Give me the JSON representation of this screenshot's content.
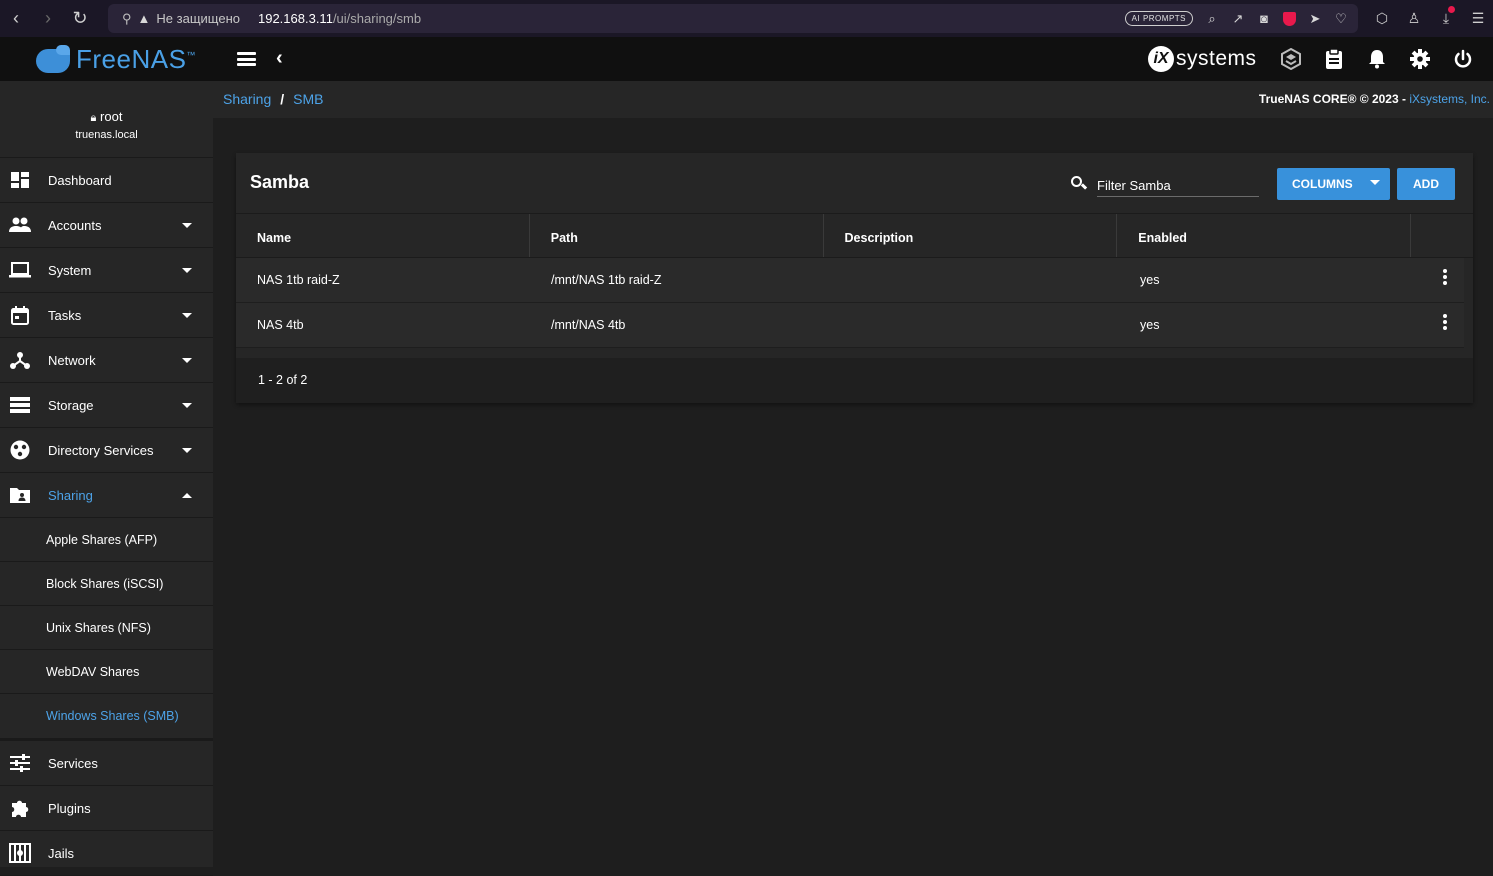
{
  "browser": {
    "insecure_label": "Не защищено",
    "url_host": "192.168.3.11",
    "url_path": "/ui/sharing/smb",
    "ai_prompts": "AI PROMPTS"
  },
  "topbar": {
    "logo_text": "FreeNAS",
    "logo_tm": "™",
    "ix_mark": "iX",
    "ix_text": "systems"
  },
  "user": {
    "name": "root",
    "host": "truenas.local"
  },
  "sidebar": {
    "items": [
      {
        "label": "Dashboard"
      },
      {
        "label": "Accounts"
      },
      {
        "label": "System"
      },
      {
        "label": "Tasks"
      },
      {
        "label": "Network"
      },
      {
        "label": "Storage"
      },
      {
        "label": "Directory Services"
      },
      {
        "label": "Sharing"
      },
      {
        "label": "Services"
      },
      {
        "label": "Plugins"
      },
      {
        "label": "Jails"
      }
    ],
    "sharing_sub": [
      {
        "label": "Apple Shares (AFP)"
      },
      {
        "label": "Block Shares (iSCSI)"
      },
      {
        "label": "Unix Shares (NFS)"
      },
      {
        "label": "WebDAV Shares"
      },
      {
        "label": "Windows Shares (SMB)"
      }
    ]
  },
  "breadcrumb": {
    "parent": "Sharing",
    "separator": "/",
    "current": "SMB"
  },
  "copyright": {
    "text": "TrueNAS CORE® © 2023 - ",
    "company": "iXsystems, Inc."
  },
  "card": {
    "title": "Samba",
    "filter_placeholder": "Filter Samba",
    "columns_label": "COLUMNS",
    "add_label": "ADD",
    "columns": [
      "Name",
      "Path",
      "Description",
      "Enabled"
    ],
    "rows": [
      {
        "name": "NAS 1tb raid-Z",
        "path": "/mnt/NAS 1tb raid-Z",
        "description": "",
        "enabled": "yes"
      },
      {
        "name": "NAS 4tb",
        "path": "/mnt/NAS 4tb",
        "description": "",
        "enabled": "yes"
      }
    ],
    "pager": "1 - 2 of 2"
  },
  "colors": {
    "accent": "#3891db",
    "link": "#4da3e8",
    "sidebar_bg": "#262626",
    "page_bg": "#1e1e1e"
  }
}
